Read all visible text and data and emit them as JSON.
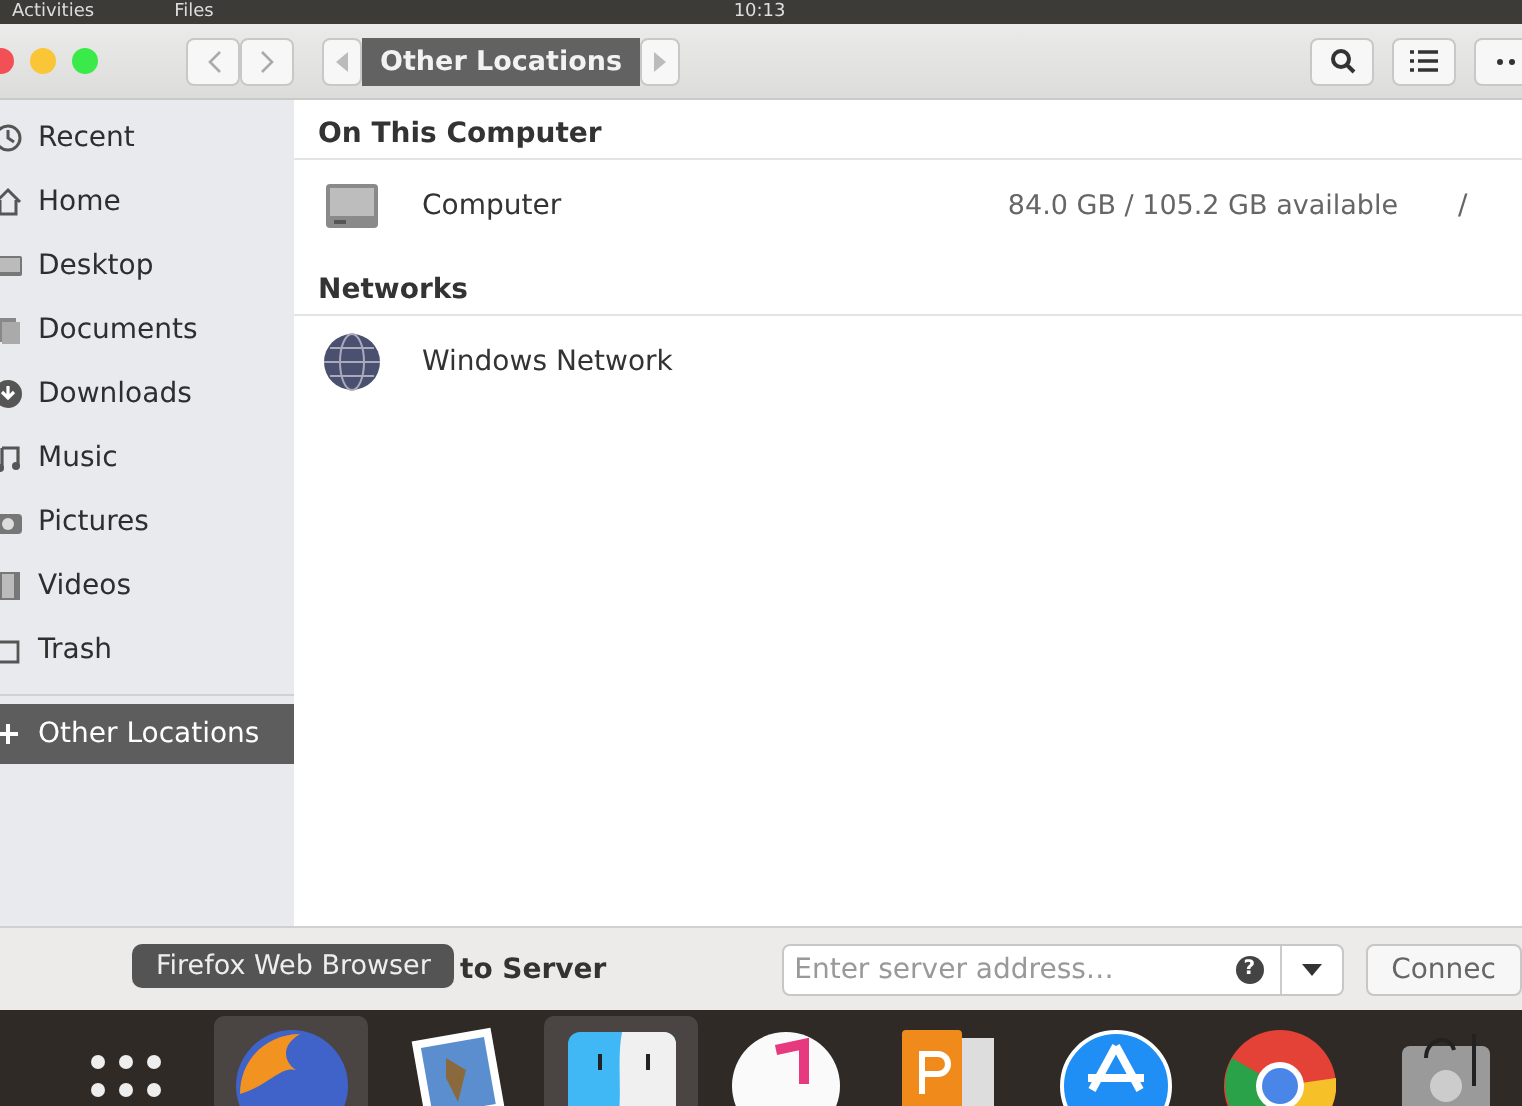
{
  "top_bar": {
    "activities": "Activities",
    "app_menu": "Files",
    "clock": "10:13"
  },
  "header": {
    "path": [
      {
        "label": "Other Locations",
        "selected": true
      }
    ]
  },
  "sidebar": {
    "items": [
      {
        "label": "Recent",
        "selected": false
      },
      {
        "label": "Home",
        "selected": false
      },
      {
        "label": "Desktop",
        "selected": false
      },
      {
        "label": "Documents",
        "selected": false
      },
      {
        "label": "Downloads",
        "selected": false
      },
      {
        "label": "Music",
        "selected": false
      },
      {
        "label": "Pictures",
        "selected": false
      },
      {
        "label": "Videos",
        "selected": false
      },
      {
        "label": "Trash",
        "selected": false
      },
      {
        "label": "Other Locations",
        "selected": true
      }
    ]
  },
  "sections": [
    {
      "title": "On This Computer",
      "rows": [
        {
          "kind": "drive",
          "name": "Computer",
          "info": "84.0 GB / 105.2 GB available",
          "path": "/"
        }
      ]
    },
    {
      "title": "Networks",
      "rows": [
        {
          "kind": "network",
          "name": "Windows Network"
        }
      ]
    }
  ],
  "footer": {
    "label": "to Server",
    "placeholder": "Enter server address…",
    "help": "?",
    "button": "Connec"
  },
  "tooltip": "Firefox Web Browser",
  "dock": [
    {
      "kind": "grid",
      "active": false
    },
    {
      "kind": "firefox",
      "active": true
    },
    {
      "kind": "preview",
      "active": false
    },
    {
      "kind": "finder",
      "active": true
    },
    {
      "kind": "music",
      "active": false
    },
    {
      "kind": "presentation",
      "active": false
    },
    {
      "kind": "store",
      "active": false
    },
    {
      "kind": "chrome",
      "active": false
    },
    {
      "kind": "disk",
      "active": false
    }
  ]
}
